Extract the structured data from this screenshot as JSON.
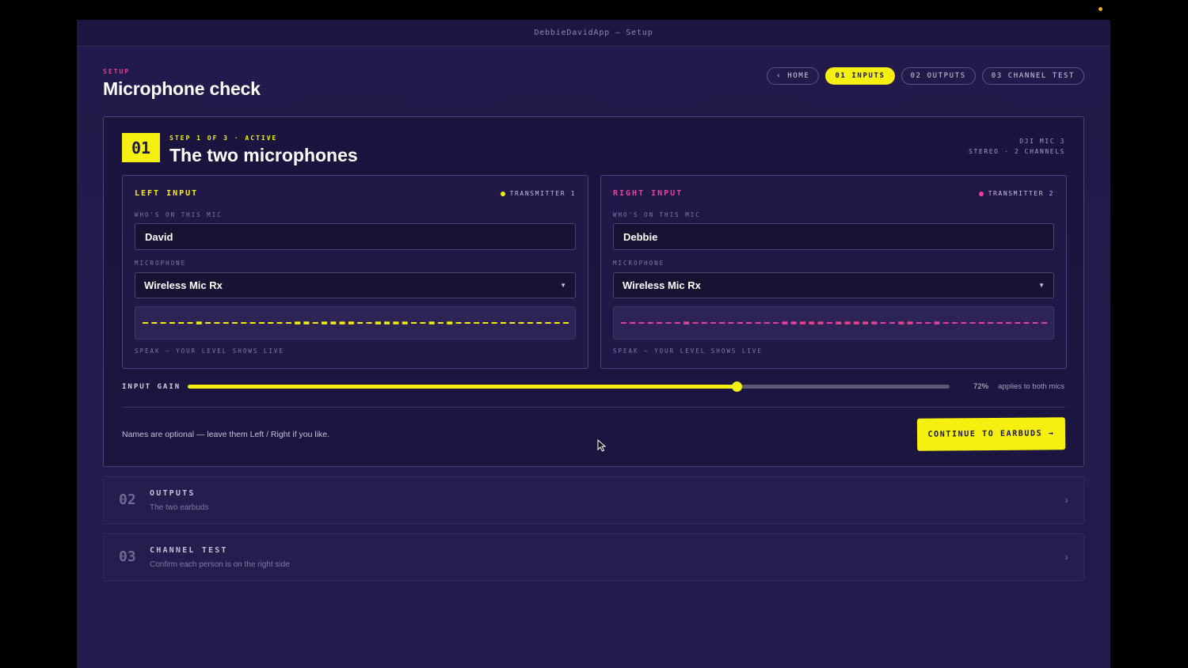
{
  "window": {
    "title": "DebbieDavidApp — Setup"
  },
  "header": {
    "eyebrow": "SETUP",
    "title": "Microphone check",
    "nav": [
      {
        "label": "‹ HOME",
        "active": false
      },
      {
        "label": "01 INPUTS",
        "active": true
      },
      {
        "label": "02 OUTPUTS",
        "active": false
      },
      {
        "label": "03 CHANNEL TEST",
        "active": false
      }
    ]
  },
  "step1": {
    "number": "01",
    "meta": "STEP 1 OF 3 · ACTIVE",
    "title": "The two microphones",
    "device_name": "DJI MIC 3",
    "device_mode": "STEREO · 2 CHANNELS",
    "left": {
      "heading": "LEFT INPUT",
      "transmitter": "TRANSMITTER 1",
      "accent": "#f5f010",
      "name_label": "WHO'S ON THIS MIC",
      "name_value": "David",
      "mic_label": "MICROPHONE",
      "mic_value": "Wireless Mic Rx",
      "hint": "SPEAK — YOUR LEVEL SHOWS LIVE"
    },
    "right": {
      "heading": "RIGHT INPUT",
      "transmitter": "TRANSMITTER 2",
      "accent": "#e8409e",
      "name_label": "WHO'S ON THIS MIC",
      "name_value": "Debbie",
      "mic_label": "MICROPHONE",
      "mic_value": "Wireless Mic Rx",
      "hint": "SPEAK — YOUR LEVEL SHOWS LIVE"
    },
    "gain": {
      "label": "INPUT GAIN",
      "value": 72,
      "value_text": "72%",
      "note": "applies to both mics"
    },
    "footnote": "Names are optional — leave them Left / Right if you like.",
    "continue_label": "CONTINUE TO EARBUDS →"
  },
  "step2": {
    "number": "02",
    "title": "OUTPUTS",
    "subtitle": "The two earbuds"
  },
  "step3": {
    "number": "03",
    "title": "CHANNEL TEST",
    "subtitle": "Confirm each person is on the right side"
  },
  "icons": {
    "caret": "caret-down-icon",
    "chevron": "chevron-right-icon",
    "cursor": "cursor-icon"
  }
}
